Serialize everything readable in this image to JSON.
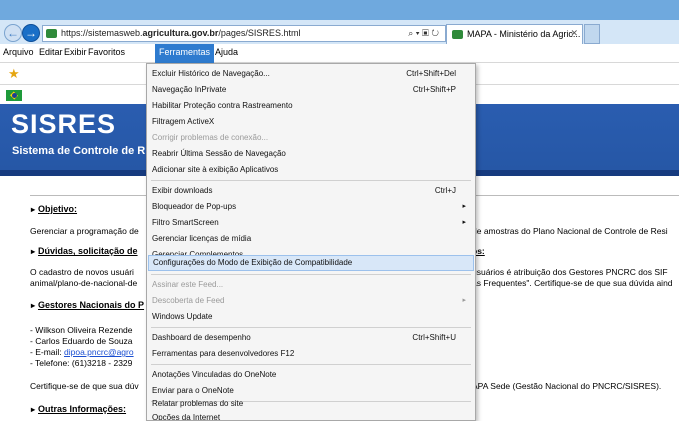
{
  "browser": {
    "url_prefix": "https://sistemasweb.",
    "url_domain": "agricultura.gov.br",
    "url_path": "/pages/SISRES.html",
    "addr_icons": "⌕ ▾ ▣ ↻",
    "tab_title": "MAPA - Ministério da Agric...",
    "tab_close": "✕",
    "back_icon": "←",
    "forward_icon": "→"
  },
  "menubar": {
    "arquivo": "Arquivo",
    "editar": "Editar",
    "exibir": "Exibir",
    "favoritos": "Favoritos",
    "ferramentas": "Ferramentas",
    "ajuda": "Ajuda"
  },
  "page": {
    "title": "SISRES",
    "subtitle": "Sistema de Controle de R",
    "sections": {
      "objetivo": "Objetivo:",
      "duvidas": "Dúvidas, solicitação de",
      "gestores": "Gestores Nacionais do P",
      "outras": "Outras Informações:"
    },
    "texts": {
      "objetivo_left": "Gerenciar a programação de",
      "objetivo_right": "de amostras do Plano Nacional de Controle de Resi",
      "duvidas_right": "os:",
      "cadastro_l1": "O cadastro de novos usuári",
      "cadastro_l2": "animal/plano-de-nacional-de",
      "cadastro_r1": "usuários é atribuição dos Gestores PNCRC dos SIF",
      "cadastro_r2": "as Frequentes\". Certifique-se de que sua dúvida aind",
      "gestor1": "- Wilkson Oliveira Rezende",
      "gestor2": "- Carlos Eduardo de Souza",
      "email_label": "- E-mail: ",
      "email_value": "dipoa.pncrc@agro",
      "telefone": "- Telefone: (61)3218 - 2329",
      "certifique": "Certifique-se de que sua dúv",
      "certifique_right": "APA Sede (Gestão Nacional do PNCRC/SISRES)."
    }
  },
  "dropdown": {
    "items": [
      {
        "label": "Excluir Histórico de Navegação...",
        "shortcut": "Ctrl+Shift+Del"
      },
      {
        "label": "Navegação InPrivate",
        "shortcut": "Ctrl+Shift+P"
      },
      {
        "label": "Habilitar Proteção contra Rastreamento",
        "shortcut": ""
      },
      {
        "label": "Filtragem ActiveX",
        "shortcut": ""
      },
      {
        "label": "Corrigir problemas de conexão...",
        "shortcut": ""
      },
      {
        "label": "Reabrir Última Sessão de Navegação",
        "shortcut": ""
      },
      {
        "label": "Adicionar site à exibição Aplicativos",
        "shortcut": ""
      },
      {
        "label": "Exibir downloads",
        "shortcut": "Ctrl+J"
      },
      {
        "label": "Bloqueador de Pop-ups",
        "shortcut": ""
      },
      {
        "label": "Filtro SmartScreen",
        "shortcut": ""
      },
      {
        "label": "Gerenciar licenças de mídia",
        "shortcut": ""
      },
      {
        "label": "Gerenciar Complementos",
        "shortcut": ""
      },
      {
        "label": "Configurações do Modo de Exibição de Compatibilidade",
        "shortcut": ""
      },
      {
        "label": "Assinar este Feed...",
        "shortcut": ""
      },
      {
        "label": "Descoberta de Feed",
        "shortcut": ""
      },
      {
        "label": "Windows Update",
        "shortcut": ""
      },
      {
        "label": "Dashboard de desempenho",
        "shortcut": "Ctrl+Shift+U"
      },
      {
        "label": "Ferramentas para desenvolvedores F12",
        "shortcut": ""
      },
      {
        "label": "Anotações Vinculadas do OneNote",
        "shortcut": ""
      },
      {
        "label": "Enviar para o OneNote",
        "shortcut": ""
      },
      {
        "label": "Relatar problemas do site",
        "shortcut": ""
      },
      {
        "label": "Opções da Internet",
        "shortcut": ""
      }
    ],
    "submenu_arrow": "▸"
  },
  "colors": {
    "menu_highlight": "#2e7bcf",
    "banner": "#2a5db0",
    "item_highlight": "#d8e7f8"
  }
}
